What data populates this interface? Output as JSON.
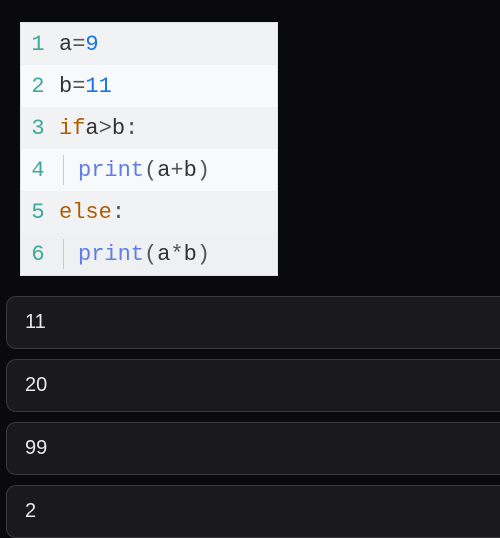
{
  "code": {
    "lines": [
      {
        "num": "1",
        "a": "a",
        "op": "=",
        "b": "9"
      },
      {
        "num": "2",
        "a": "b",
        "op": "=",
        "b": "11"
      },
      {
        "num": "3",
        "kw": "if",
        "a": "a",
        "op": ">",
        "b": "b",
        "colon": ":"
      },
      {
        "num": "4",
        "fn": "print",
        "lp": "(",
        "a": "a",
        "op": "+",
        "b": "b",
        "rp": ")"
      },
      {
        "num": "5",
        "kw": "else",
        "colon": ":"
      },
      {
        "num": "6",
        "fn": "print",
        "lp": "(",
        "a": "a",
        "op": "*",
        "b": "b",
        "rp": ")"
      }
    ]
  },
  "answers": [
    {
      "label": "11"
    },
    {
      "label": "20"
    },
    {
      "label": "99"
    },
    {
      "label": "2"
    }
  ]
}
